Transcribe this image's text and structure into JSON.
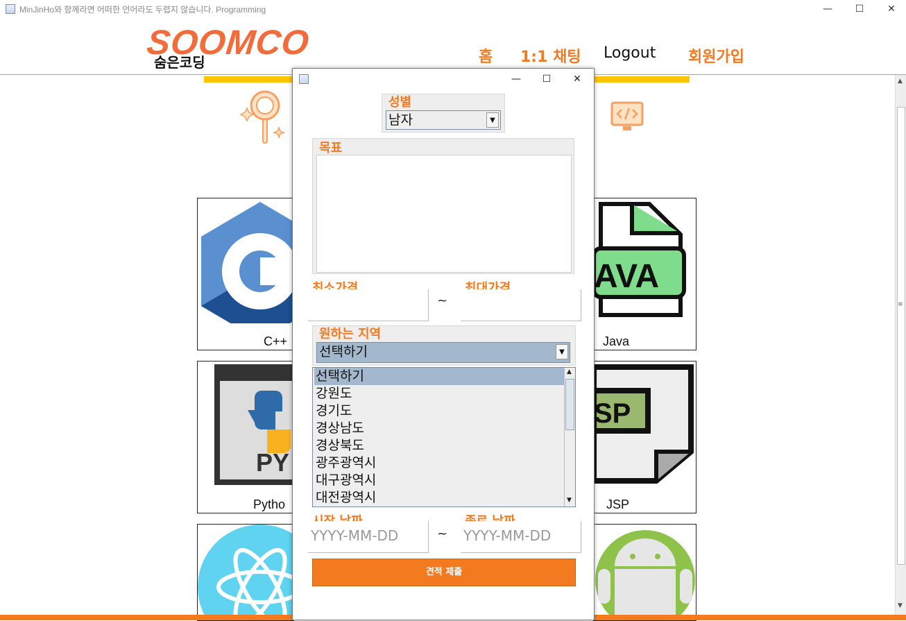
{
  "window": {
    "title": "MinJinHo와 함께라면 어떠한 언어라도 두렵지 않습니다. Programming",
    "minimize": "—",
    "maximize": "☐",
    "close": "✕"
  },
  "brand": {
    "logo": "SOOMCO",
    "sub": "숨은코딩"
  },
  "nav": {
    "home": "홈",
    "chat": "1:1 채팅",
    "logout": "Logout",
    "signup": "회원가입"
  },
  "cards": [
    {
      "label": "C++"
    },
    {
      "label": "Java"
    },
    {
      "label": "Pytho"
    },
    {
      "label": "JSP"
    }
  ],
  "dialog": {
    "minimize": "—",
    "maximize": "☐",
    "close": "✕",
    "gender": {
      "label": "성별",
      "value": "남자"
    },
    "goal": {
      "label": "목표",
      "value": ""
    },
    "price": {
      "min_label": "최소가격",
      "max_label": "최대가격",
      "separator": "~",
      "min_value": "",
      "max_value": ""
    },
    "region": {
      "label": "원하는 지역",
      "value": "선택하기",
      "options": [
        "선택하기",
        "강원도",
        "경기도",
        "경상남도",
        "경상북도",
        "광주광역시",
        "대구광역시",
        "대전광역시"
      ]
    },
    "date": {
      "start_label": "시작 날짜",
      "end_label": "종료 날짜",
      "separator": "~",
      "start_placeholder": "YYYY-MM-DD",
      "end_placeholder": "YYYY-MM-DD"
    },
    "submit": "견적 제출"
  },
  "colors": {
    "accent": "#f47a20",
    "brand": "#f26b3a",
    "bar": "#ffc400",
    "selection": "#a3b8cc"
  }
}
